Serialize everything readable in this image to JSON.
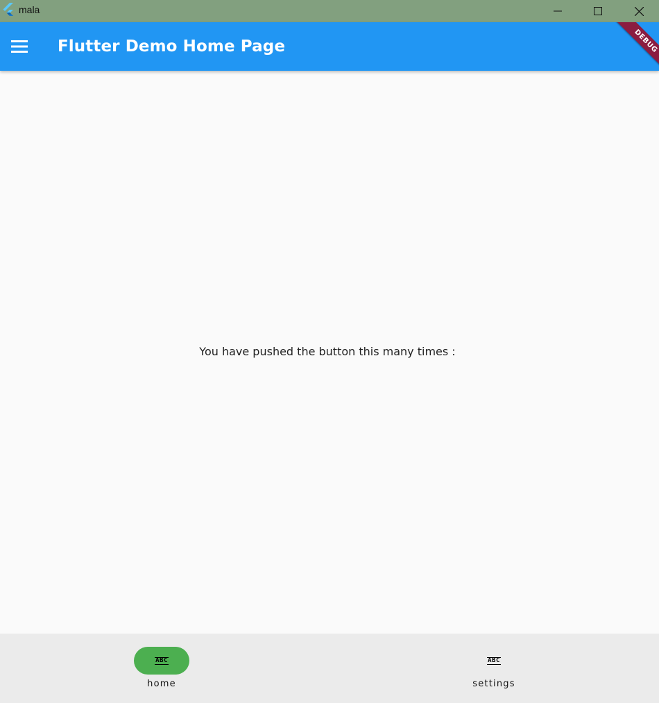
{
  "window": {
    "title": "mala",
    "icons": [
      "flutter-logo-icon",
      "minimize-icon",
      "maximize-icon",
      "close-icon"
    ]
  },
  "appbar": {
    "title": "Flutter Demo Home Page",
    "menu_icon": "menu-icon",
    "color": "#2196f3",
    "debug_banner": "DEBUG",
    "debug_color": "#8b1d41"
  },
  "body": {
    "counter_text": "You have pushed the button this many times :"
  },
  "bottom_nav": {
    "items": [
      {
        "label": "home",
        "icon": "ABC",
        "selected": true
      },
      {
        "label": "settings",
        "icon": "ABC",
        "selected": false
      }
    ],
    "indicator_color": "#4caf50",
    "background": "#ebebeb"
  }
}
